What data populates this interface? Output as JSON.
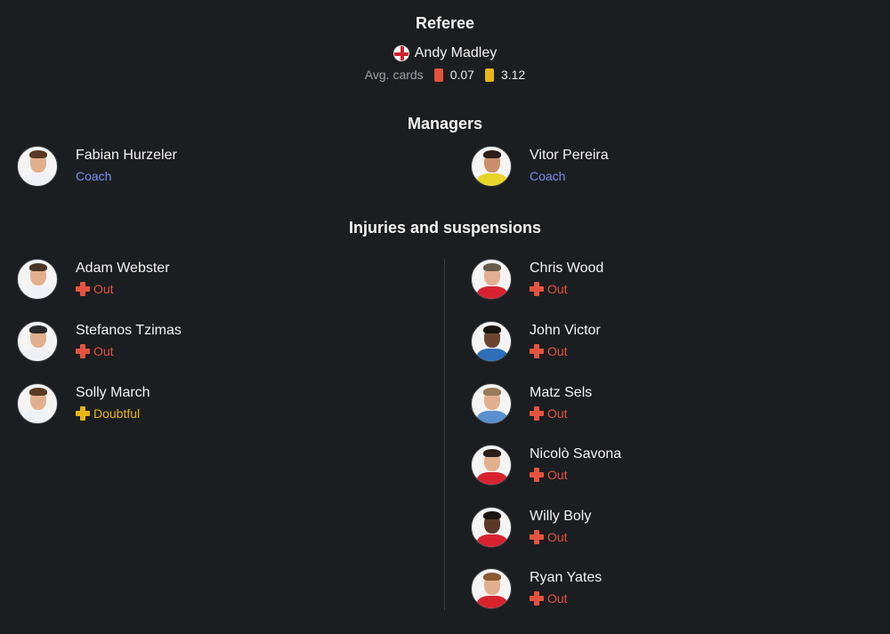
{
  "referee": {
    "title": "Referee",
    "name": "Andy Madley",
    "flag_icon": "england-flag-icon",
    "avg_cards_label": "Avg. cards",
    "red_value": "0.07",
    "yellow_value": "3.12",
    "colors": {
      "red_card": "#e5533f",
      "yellow_card": "#e8b512"
    }
  },
  "managers": {
    "title": "Managers",
    "home": {
      "name": "Fabian Hurzeler",
      "role": "Coach"
    },
    "away": {
      "name": "Vitor Pereira",
      "role": "Coach"
    }
  },
  "injuries": {
    "title": "Injuries and suspensions",
    "home": [
      {
        "name": "Adam Webster",
        "status": "Out"
      },
      {
        "name": "Stefanos Tzimas",
        "status": "Out"
      },
      {
        "name": "Solly March",
        "status": "Doubtful"
      }
    ],
    "away": [
      {
        "name": "Chris Wood",
        "status": "Out"
      },
      {
        "name": "John Victor",
        "status": "Out"
      },
      {
        "name": "Matz Sels",
        "status": "Out"
      },
      {
        "name": "Nicolò Savona",
        "status": "Out"
      },
      {
        "name": "Willy Boly",
        "status": "Out"
      },
      {
        "name": "Ryan Yates",
        "status": "Out"
      }
    ]
  },
  "colors": {
    "background": "#1b1e21",
    "coach": "#7a8bf0",
    "out": "#e5533f",
    "doubtful": "#e8b512"
  }
}
